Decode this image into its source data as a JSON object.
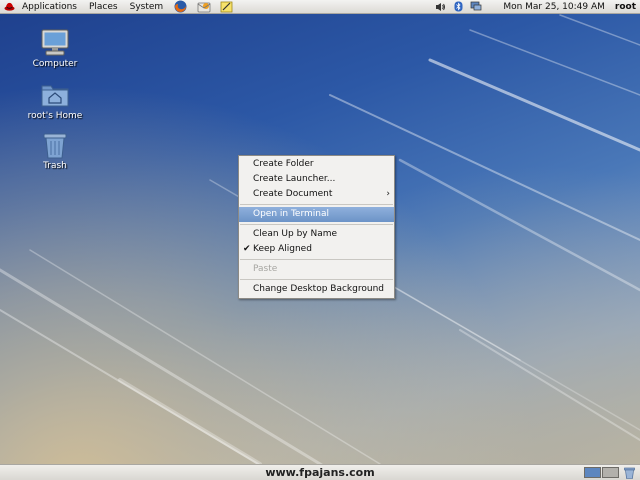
{
  "top_panel": {
    "menus": [
      "Applications",
      "Places",
      "System"
    ],
    "clock": "Mon Mar 25, 10:49 AM",
    "user": "root",
    "launchers": [
      "firefox-icon",
      "evolution-mail-icon",
      "text-editor-icon"
    ],
    "tray": [
      "volume-icon",
      "bluetooth-icon",
      "network-icon"
    ]
  },
  "desktop_icons": [
    {
      "label": "Computer",
      "icon": "computer-icon"
    },
    {
      "label": "root's Home",
      "icon": "home-folder-icon"
    },
    {
      "label": "Trash",
      "icon": "trash-icon"
    }
  ],
  "context_menu": {
    "items": [
      {
        "label": "Create Folder"
      },
      {
        "label": "Create Launcher..."
      },
      {
        "label": "Create Document",
        "submenu": "›"
      },
      {
        "label": "Open in Terminal",
        "state": "highlighted"
      },
      {
        "label": "Clean Up by Name"
      },
      {
        "label": "Keep Aligned",
        "checkmark": "✔"
      },
      {
        "label": "Paste",
        "state": "disabled"
      },
      {
        "label": "Change Desktop Background"
      }
    ]
  },
  "bottom_panel": {
    "watermark": "www.fpajans.com",
    "workspaces": [
      "workspace-1",
      "workspace-2"
    ]
  },
  "colors": {
    "menu_highlight": "#7aa0d0",
    "desktop_blue": "#2c58a6"
  }
}
